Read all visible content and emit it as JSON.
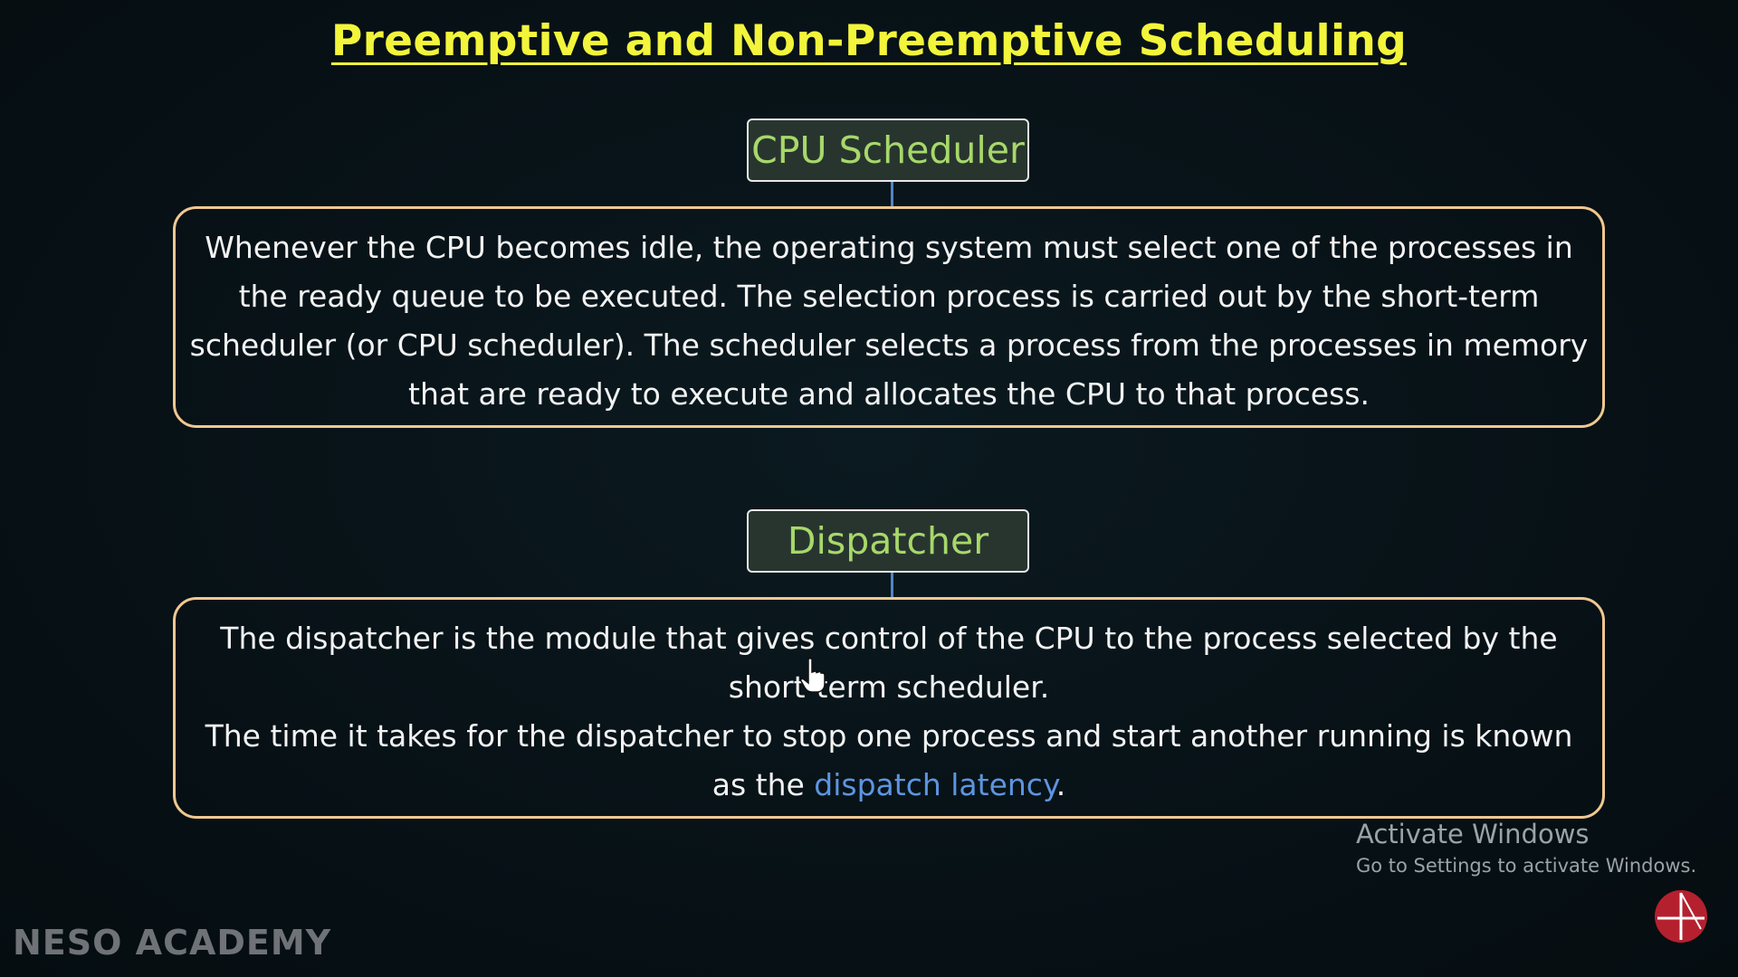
{
  "title": "Preemptive and Non-Preemptive Scheduling",
  "sections": [
    {
      "label": "CPU Scheduler",
      "paragraphs": [
        "Whenever the CPU becomes idle, the operating system must select one of the processes in the ready queue to be executed. The selection process is carried out by the short-term scheduler (or CPU scheduler). The scheduler selects a process from the processes in memory that are ready to execute and allocates the CPU to that process."
      ]
    },
    {
      "label": "Dispatcher",
      "paragraphs": [
        "The dispatcher is the module that gives control of the CPU to the process selected by the short-term scheduler.",
        "The time it takes for the dispatcher to stop one process and start another running is known as the "
      ],
      "highlight": "dispatch latency",
      "trailing": "."
    }
  ],
  "watermark": {
    "title": "Activate Windows",
    "subtitle": "Go to Settings to activate Windows."
  },
  "brand": "NESO ACADEMY",
  "icons": {
    "logo": "neso-academy-logo-icon",
    "cursor": "hand-pointer-cursor-icon"
  },
  "colors": {
    "background": "#071116",
    "title": "#f2f53a",
    "label_text": "#a7d86a",
    "label_bg": "#28352f",
    "box_border": "#f0c890",
    "connector": "#4f86c6",
    "highlight": "#5d95e0",
    "logo": "#b5202f"
  }
}
